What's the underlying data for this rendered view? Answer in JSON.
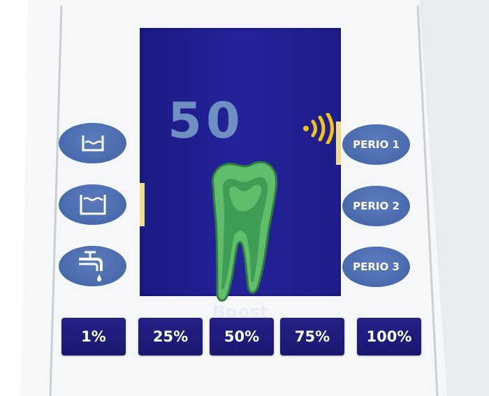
{
  "display": {
    "intensity_value": "50",
    "mode_label": "Boost",
    "wave_icon": "ultrasonic-wave-icon",
    "tooth_icon": "tooth-icon"
  },
  "left_buttons": [
    {
      "icon": "reservoir-low-icon"
    },
    {
      "icon": "reservoir-full-icon"
    },
    {
      "icon": "water-tap-icon"
    }
  ],
  "right_buttons": [
    {
      "label": "PERIO 1"
    },
    {
      "label": "PERIO 2"
    },
    {
      "label": "PERIO 3"
    }
  ],
  "power_buttons": [
    {
      "label": "1%"
    },
    {
      "label": "25%"
    },
    {
      "label": "50%"
    },
    {
      "label": "75%"
    },
    {
      "label": "100%"
    }
  ],
  "colors": {
    "screen": "#1f1e88",
    "button_oval": "#4d6fb1",
    "button_square": "#1f1b7a",
    "intensity_text": "#6f8ec2",
    "accent_yellow": "#f0dc8c",
    "tooth_fill": "#5fbd6c",
    "tooth_outline": "#2f7d3e"
  }
}
